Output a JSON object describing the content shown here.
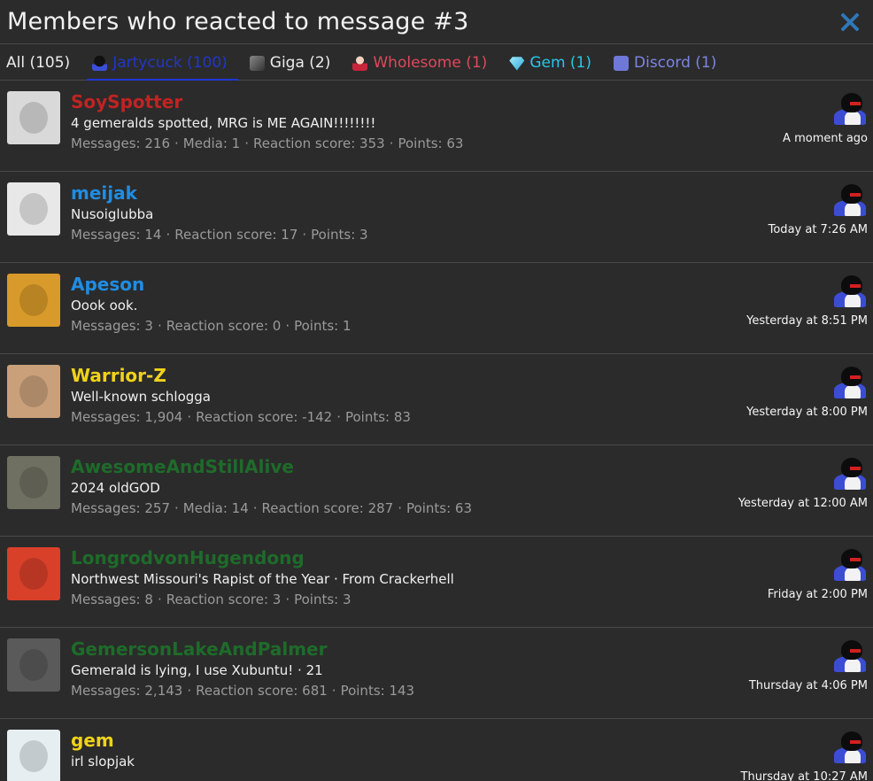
{
  "dialog": {
    "title": "Members who reacted to message #3"
  },
  "tabs": [
    {
      "label": "All (105)",
      "icon": null
    },
    {
      "label": "Jartycuck (100)",
      "icon": "penguin-icon"
    },
    {
      "label": "Giga (2)",
      "icon": "giga-icon"
    },
    {
      "label": "Wholesome (1)",
      "icon": "wholesome-icon"
    },
    {
      "label": "Gem (1)",
      "icon": "gem-icon"
    },
    {
      "label": "Discord (1)",
      "icon": "discord-icon"
    }
  ],
  "members": [
    {
      "username": "SoySpotter",
      "name_color": "#c12323",
      "avatar_color": "#d9d9d9",
      "tagline": "4 gemeralds spotted, MRG is ME AGAIN!!!!!!!!",
      "stats": [
        "Messages: 216",
        "Media: 1",
        "Reaction score: 353",
        "Points: 63"
      ],
      "time": "A moment ago"
    },
    {
      "username": "meijak",
      "name_color": "#1f8de3",
      "avatar_color": "#e8e8e8",
      "tagline": "Nusoiglubba",
      "stats": [
        "Messages: 14",
        "Reaction score: 17",
        "Points: 3"
      ],
      "time": "Today at 7:26 AM"
    },
    {
      "username": "Apeson",
      "name_color": "#1f8de3",
      "avatar_color": "#d89a2a",
      "tagline": "Oook ook.",
      "stats": [
        "Messages: 3",
        "Reaction score: 0",
        "Points: 1"
      ],
      "time": "Yesterday at 8:51 PM"
    },
    {
      "username": "Warrior-Z",
      "name_color": "#f0d21a",
      "avatar_color": "#c9a07a",
      "tagline": "Well-known schlogga",
      "stats": [
        "Messages: 1,904",
        "Reaction score: -142",
        "Points: 83"
      ],
      "time": "Yesterday at 8:00 PM"
    },
    {
      "username": "AwesomeAndStillAlive",
      "name_color": "#1e6b2a",
      "avatar_color": "#6f6f62",
      "tagline": "2024 oldGOD",
      "stats": [
        "Messages: 257",
        "Media: 14",
        "Reaction score: 287",
        "Points: 63"
      ],
      "time": "Yesterday at 12:00 AM"
    },
    {
      "username": "LongrodvonHugendong",
      "name_color": "#1e6b2a",
      "avatar_color": "#d8402a",
      "tagline": "Northwest Missouri's Rapist of the Year · From Crackerhell",
      "stats": [
        "Messages: 8",
        "Reaction score: 3",
        "Points: 3"
      ],
      "time": "Friday at 2:00 PM"
    },
    {
      "username": "GemersonLakeAndPalmer",
      "name_color": "#1e6b2a",
      "avatar_color": "#5a5a5a",
      "tagline": "Gemerald is lying, I use Xubuntu! · 21",
      "stats": [
        "Messages: 2,143",
        "Reaction score: 681",
        "Points: 143"
      ],
      "time": "Thursday at 4:06 PM"
    },
    {
      "username": "gem",
      "name_color": "#f0d21a",
      "avatar_color": "#e6eef2",
      "tagline": "irl slopjak",
      "stats": [],
      "time": "Thursday at 10:27 AM"
    }
  ],
  "reaction_icon": "penguin-reaction-icon"
}
